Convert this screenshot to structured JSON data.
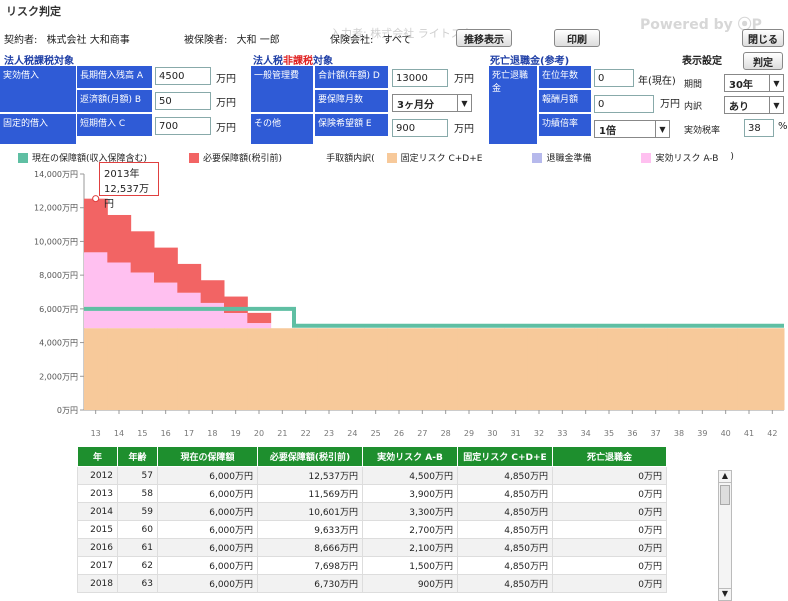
{
  "app": {
    "title": "リスク判定",
    "faint_text": "入力者: 株式会社 ライトスタッフ",
    "powered": "Powered by ⦿P"
  },
  "header": {
    "contractor_label": "契約者:",
    "contractor": "株式会社 大和商事",
    "insured_label": "被保険者:",
    "insured": "大和 一郎",
    "insurer_label": "保険会社:",
    "insurer": "すべて",
    "trend_button": "推移表示",
    "print_button": "印刷",
    "close_button": "閉じる"
  },
  "sections": {
    "corp_tax": "法人税課税対象",
    "corp_nontax_a": "法人税",
    "corp_nontax_b": "非課税",
    "corp_nontax_c": "対象",
    "death_retire": "死亡退職金(参考)"
  },
  "form": {
    "lbl_active": "実効借入",
    "lbl_fixed": "固定的借入",
    "long_label": "長期借入残高 A",
    "long_value": "4500",
    "long_unit": "万円",
    "repay_label": "返済額(月額) B",
    "repay_value": "50",
    "repay_unit": "万円",
    "short_label": "短期借入 C",
    "short_value": "700",
    "short_unit": "万円",
    "gen_label": "一般管理費",
    "other_label": "その他",
    "total_label": "合計額(年額) D",
    "total_value": "13000",
    "total_unit": "万円",
    "months_label": "要保障月数",
    "months_value": "3ヶ月分",
    "hope_label": "保険希望額 E",
    "hope_value": "900",
    "hope_unit": "万円",
    "death_label": "死亡退職金",
    "tenure_label": "在位年数",
    "tenure_value": "0",
    "tenure_unit": "年(現在)",
    "reward_label": "報酬月額",
    "reward_value": "0",
    "reward_unit": "万円",
    "merit_label": "功績倍率",
    "merit_value": "1倍"
  },
  "display": {
    "title": "表示設定",
    "judge_button": "判定",
    "period_label": "期間",
    "period_value": "30年",
    "breakdown_label": "内訳",
    "breakdown_value": "あり",
    "tax_label": "実効税率",
    "tax_value": "38",
    "tax_unit": "%"
  },
  "legend": {
    "current": "現在の保障額(収入保障含む)",
    "needed": "必要保障額(税引前)",
    "breakdown": "手取額内訳(",
    "fixed": "固定リスク C+D+E",
    "retire": "退職金準備",
    "active": "実効リスク A-B",
    "close": ")"
  },
  "colors": {
    "green": "#5fbfa3",
    "red": "#f26464",
    "pink": "#ffc0f0",
    "orange": "#f7c99a",
    "lav": "#b6b9ec",
    "header": "#1e8f2e",
    "blue": "#2f5bd6"
  },
  "tooltip": {
    "year": "2013年",
    "value": "12,537万円"
  },
  "chart_data": {
    "type": "area",
    "x": [
      "13",
      "14",
      "15",
      "16",
      "17",
      "18",
      "19",
      "20",
      "21",
      "22",
      "23",
      "24",
      "25",
      "26",
      "27",
      "28",
      "29",
      "30",
      "31",
      "32",
      "33",
      "34",
      "35",
      "36",
      "37",
      "38",
      "39",
      "40",
      "41",
      "42"
    ],
    "yticks": [
      "14,000万円",
      "12,000万円",
      "10,000万円",
      "8,000万円",
      "6,000万円",
      "4,000万円",
      "2,000万円",
      "0万円"
    ],
    "ylim": [
      0,
      14000
    ],
    "fixed": [
      4850,
      4850,
      4850,
      4850,
      4850,
      4850,
      4850,
      4850,
      4850,
      4850,
      4850,
      4850,
      4850,
      4850,
      4850,
      4850,
      4850,
      4850,
      4850,
      4850,
      4850,
      4850,
      4850,
      4850,
      4850,
      4850,
      4850,
      4850,
      4850,
      4850
    ],
    "active": [
      4500,
      3900,
      3300,
      2700,
      2100,
      1500,
      900,
      300,
      0,
      0,
      0,
      0,
      0,
      0,
      0,
      0,
      0,
      0,
      0,
      0,
      0,
      0,
      0,
      0,
      0,
      0,
      0,
      0,
      0,
      0
    ],
    "needed": [
      12537,
      11569,
      10601,
      9633,
      8666,
      7698,
      6730,
      5762,
      4850,
      4850,
      4850,
      4850,
      4850,
      4850,
      4850,
      4850,
      4850,
      4850,
      4850,
      4850,
      4850,
      4850,
      4850,
      4850,
      4850,
      4850,
      4850,
      4850,
      4850,
      4850
    ],
    "current": [
      6000,
      6000,
      6000,
      6000,
      6000,
      6000,
      6000,
      6000,
      6000,
      5000,
      5000,
      5000,
      5000,
      5000,
      5000,
      5000,
      5000,
      5000,
      5000,
      5000,
      5000,
      5000,
      5000,
      5000,
      5000,
      5000,
      5000,
      5000,
      5000,
      5000
    ]
  },
  "table": {
    "headers": [
      "年",
      "年齢",
      "現在の保障額",
      "必要保障額(税引前)",
      "実効リスク A-B",
      "固定リスク C+D+E",
      "死亡退職金"
    ],
    "rows": [
      [
        "2012",
        "57",
        "6,000万円",
        "12,537万円",
        "4,500万円",
        "4,850万円",
        "0万円"
      ],
      [
        "2013",
        "58",
        "6,000万円",
        "11,569万円",
        "3,900万円",
        "4,850万円",
        "0万円"
      ],
      [
        "2014",
        "59",
        "6,000万円",
        "10,601万円",
        "3,300万円",
        "4,850万円",
        "0万円"
      ],
      [
        "2015",
        "60",
        "6,000万円",
        "9,633万円",
        "2,700万円",
        "4,850万円",
        "0万円"
      ],
      [
        "2016",
        "61",
        "6,000万円",
        "8,666万円",
        "2,100万円",
        "4,850万円",
        "0万円"
      ],
      [
        "2017",
        "62",
        "6,000万円",
        "7,698万円",
        "1,500万円",
        "4,850万円",
        "0万円"
      ],
      [
        "2018",
        "63",
        "6,000万円",
        "6,730万円",
        "900万円",
        "4,850万円",
        "0万円"
      ]
    ]
  }
}
